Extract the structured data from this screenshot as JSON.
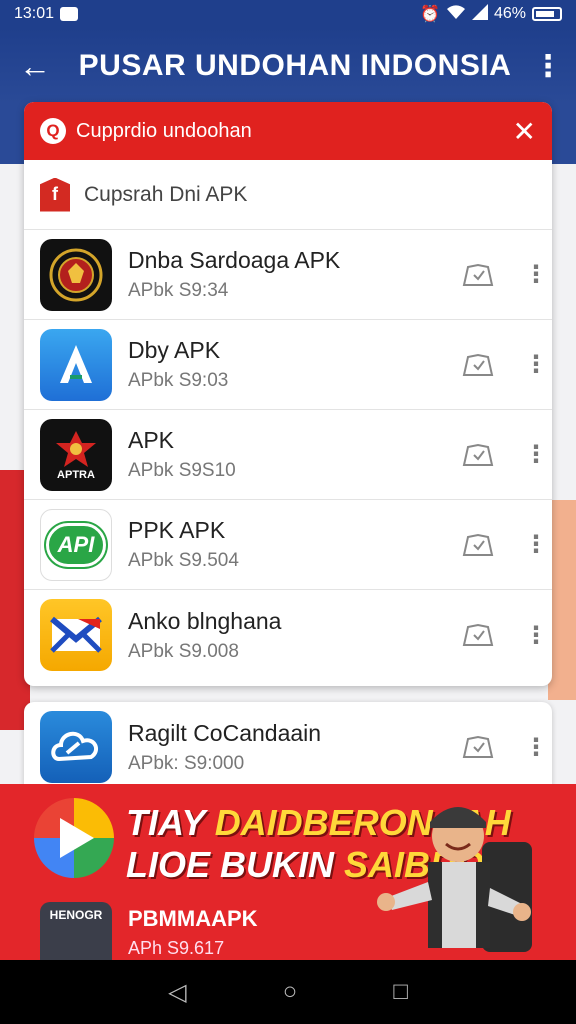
{
  "status_bar": {
    "time": "13:01",
    "battery": "46%"
  },
  "app_bar": {
    "title": "PUSAR UNDOHAN INDONSIA",
    "back_icon": "arrow-left-icon",
    "menu_icon": "more-vert-icon"
  },
  "search": {
    "text": "Cupprdio undoohan"
  },
  "section": {
    "label": "Cupsrah Dni APK"
  },
  "apps": [
    {
      "name": "Dnba Sardoaga APK",
      "sub": "APbk S9:34"
    },
    {
      "name": "Dby APK",
      "sub": "APbk S9:03"
    },
    {
      "name": "APK",
      "sub": "APbk S9S10",
      "icon_text": "APTRA"
    },
    {
      "name": "PPK APK",
      "sub": "APbk S9.504",
      "icon_text": "API"
    },
    {
      "name": "Anko blnghana",
      "sub": "APbk S9.008"
    }
  ],
  "app_extra": {
    "name": "Ragilt CoCandaain",
    "sub": "APbk: S9:000"
  },
  "banner": {
    "line1_a": "TIAY ",
    "line1_b": "DAIDBERONAAH",
    "line2_a": "LIOE BUKIN ",
    "line2_b": "SAIBRO",
    "icon_text": "HENOGR",
    "app_name": "PBMMAAPK",
    "app_sub": "APh S9.617"
  },
  "nav": {
    "back": "◁",
    "home": "○",
    "recents": "□"
  },
  "colors": {
    "primary": "#1f3f8c",
    "accent_red": "#e0221f"
  }
}
